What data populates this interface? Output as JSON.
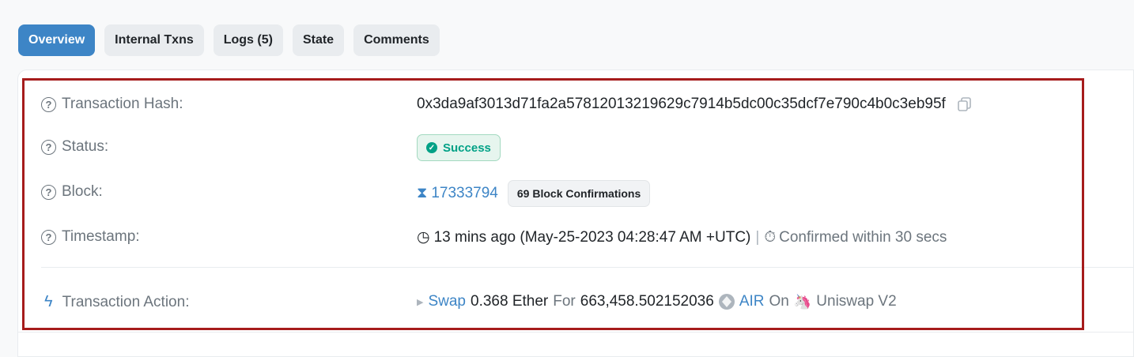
{
  "tabs": [
    {
      "label": "Overview",
      "active": true
    },
    {
      "label": "Internal Txns",
      "active": false
    },
    {
      "label": "Logs (5)",
      "active": false
    },
    {
      "label": "State",
      "active": false
    },
    {
      "label": "Comments",
      "active": false
    }
  ],
  "fields": {
    "hash": {
      "label": "Transaction Hash:",
      "value": "0x3da9af3013d71fa2a57812013219629c7914b5dc00c35dcf7e790c4b0c3eb95f"
    },
    "status": {
      "label": "Status:",
      "value": "Success"
    },
    "block": {
      "label": "Block:",
      "number": "17333794",
      "confirmations": "69 Block Confirmations"
    },
    "timestamp": {
      "label": "Timestamp:",
      "value": "13 mins ago (May-25-2023 04:28:47 AM +UTC)",
      "separator": "|",
      "confirmed": "Confirmed within 30 secs"
    },
    "action": {
      "label": "Transaction Action:",
      "verb": "Swap",
      "amount_in": "0.368 Ether",
      "for_word": "For",
      "amount_out": "663,458.502152036",
      "token": "AIR",
      "on_word": "On",
      "dex": "Uniswap V2"
    }
  },
  "colors": {
    "accent": "#3d85c6",
    "success": "#00a186",
    "highlight_border": "#a61c1c"
  }
}
